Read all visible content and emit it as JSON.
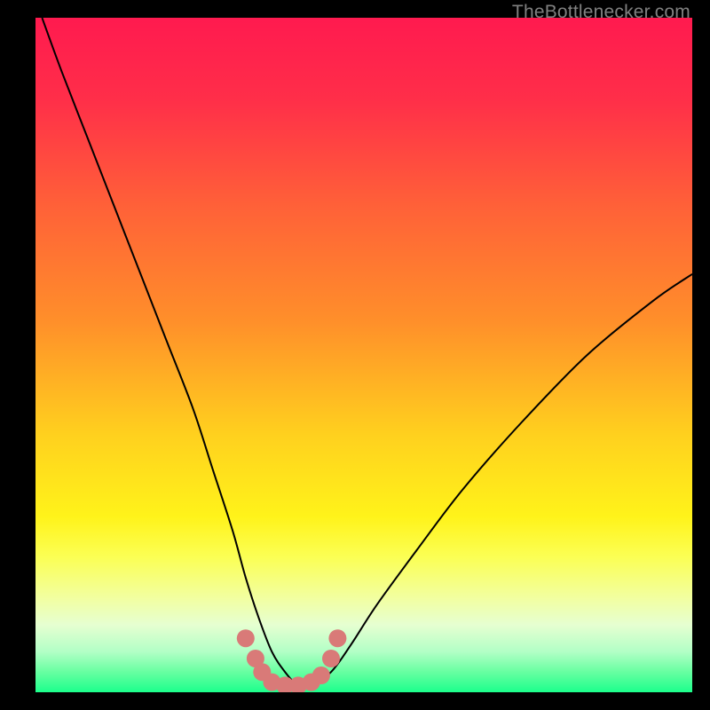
{
  "watermark": "TheBottlenecker.com",
  "chart_data": {
    "type": "line",
    "title": "",
    "xlabel": "",
    "ylabel": "",
    "xlim": [
      0,
      100
    ],
    "ylim": [
      0,
      100
    ],
    "grid": false,
    "legend": false,
    "background_gradient_stops": [
      {
        "t": 0.0,
        "color": "#ff1a4f"
      },
      {
        "t": 0.12,
        "color": "#ff2e49"
      },
      {
        "t": 0.28,
        "color": "#ff6138"
      },
      {
        "t": 0.45,
        "color": "#ff8f2a"
      },
      {
        "t": 0.62,
        "color": "#ffd11e"
      },
      {
        "t": 0.74,
        "color": "#fff31a"
      },
      {
        "t": 0.8,
        "color": "#fbff55"
      },
      {
        "t": 0.86,
        "color": "#f2ffa0"
      },
      {
        "t": 0.9,
        "color": "#e6ffd1"
      },
      {
        "t": 0.94,
        "color": "#b2ffc6"
      },
      {
        "t": 0.97,
        "color": "#67ffa1"
      },
      {
        "t": 1.0,
        "color": "#1cff8c"
      }
    ],
    "series": [
      {
        "name": "bottleneck-curve",
        "color": "#000000",
        "width": 2,
        "x": [
          1,
          4,
          8,
          12,
          16,
          20,
          24,
          27,
          30,
          32,
          34,
          36,
          38,
          40,
          42,
          45,
          48,
          52,
          58,
          65,
          74,
          84,
          94,
          100
        ],
        "y": [
          100,
          92,
          82,
          72,
          62,
          52,
          42,
          33,
          24,
          17,
          11,
          6,
          3,
          1,
          1,
          3,
          7,
          13,
          21,
          30,
          40,
          50,
          58,
          62
        ]
      },
      {
        "name": "highlight-dots",
        "color": "#d97a78",
        "marker": "circle",
        "marker_size": 20,
        "x": [
          32,
          33.5,
          34.5,
          36,
          38,
          40,
          42,
          43.5,
          45,
          46
        ],
        "y": [
          8,
          5,
          3,
          1.5,
          1,
          1,
          1.5,
          2.5,
          5,
          8
        ]
      }
    ]
  }
}
